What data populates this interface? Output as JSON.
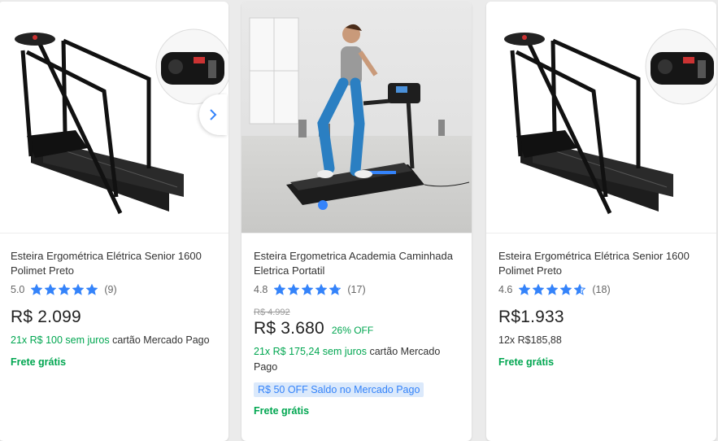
{
  "colors": {
    "accent_blue": "#3483fa",
    "green": "#00a650",
    "promo_bg": "#dbe9fb",
    "star_fill": "#3483fa",
    "background": "#ebebeb"
  },
  "icons": {
    "next": "chevron-right-icon",
    "star": "star-icon"
  },
  "products": [
    {
      "title": "Esteira Ergométrica Elétrica Senior 1600 Polimet Preto",
      "rating": "5.0",
      "rating_value": 5.0,
      "reviews": "(9)",
      "price": "R$ 2.099",
      "installment_green": "21x R$ 100 sem juros",
      "installment_rest": " cartão Mercado Pago",
      "shipping": "Frete grátis"
    },
    {
      "title": "Esteira Ergometrica Academia Caminhada Eletrica Portatil",
      "rating": "4.8",
      "rating_value": 4.8,
      "reviews": "(17)",
      "old_price": "R$ 4.992",
      "price": "R$ 3.680",
      "discount": "26% OFF",
      "installment_green": "21x R$ 175,24 sem juros",
      "installment_rest": " cartão Mercado Pago",
      "promo": "R$ 50 OFF Saldo no Mercado Pago",
      "shipping": "Frete grátis"
    },
    {
      "title": "Esteira Ergométrica Elétrica Senior 1600 Polimet Preto",
      "rating": "4.6",
      "rating_value": 4.6,
      "reviews": "(18)",
      "price": "R$1.933",
      "installment_plain": "12x R$185,88",
      "shipping": "Frete grátis"
    }
  ]
}
